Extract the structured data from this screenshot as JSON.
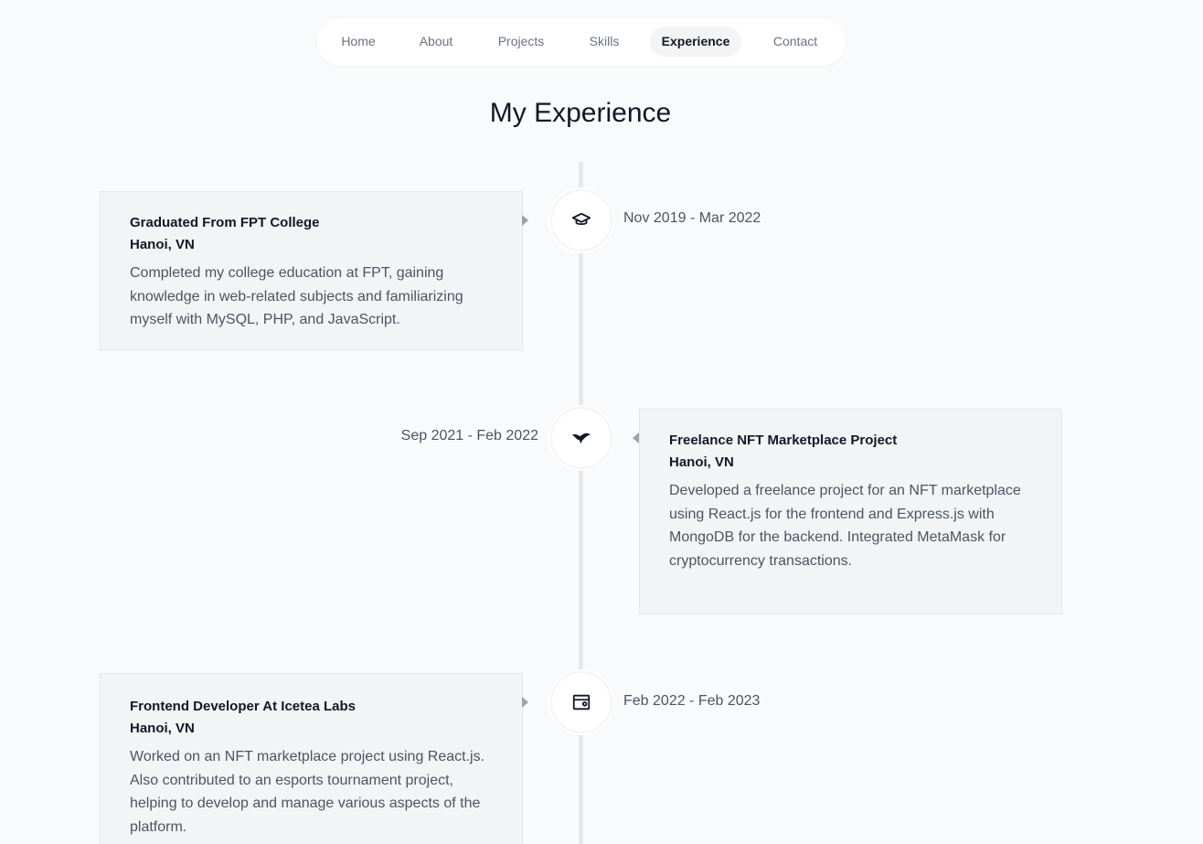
{
  "nav": {
    "items": [
      {
        "label": "Home"
      },
      {
        "label": "About"
      },
      {
        "label": "Projects"
      },
      {
        "label": "Skills"
      },
      {
        "label": "Experience"
      },
      {
        "label": "Contact"
      }
    ],
    "active": "Experience"
  },
  "page_title": "My Experience",
  "timeline": [
    {
      "icon": "graduation-cap-icon",
      "date": "Nov 2019 - Mar 2022",
      "title": "Graduated From FPT College",
      "location": "Hanoi, VN",
      "description": "Completed my college education at FPT, gaining knowledge in web-related subjects and familiarizing myself with MySQL, PHP, and JavaScript."
    },
    {
      "icon": "hummingbird-icon",
      "date": "Sep 2021 - Feb 2022",
      "title": "Freelance NFT Marketplace Project",
      "location": "Hanoi, VN",
      "description": "Developed a freelance project for an NFT marketplace using React.js for the frontend and Express.js with MongoDB for the backend. Integrated MetaMask for cryptocurrency transactions."
    },
    {
      "icon": "wallet-icon",
      "date": "Feb 2022 - Feb 2023",
      "title": "Frontend Developer At Icetea Labs",
      "location": "Hanoi, VN",
      "description": "Worked on an NFT marketplace project using React.js. Also contributed to an esports tournament project, helping to develop and manage various aspects of the platform."
    }
  ],
  "colors": {
    "background": "#f9fafb",
    "card": "#f3f4f6",
    "line": "#e5e7eb",
    "text": "#111827",
    "muted": "#4b5563"
  }
}
